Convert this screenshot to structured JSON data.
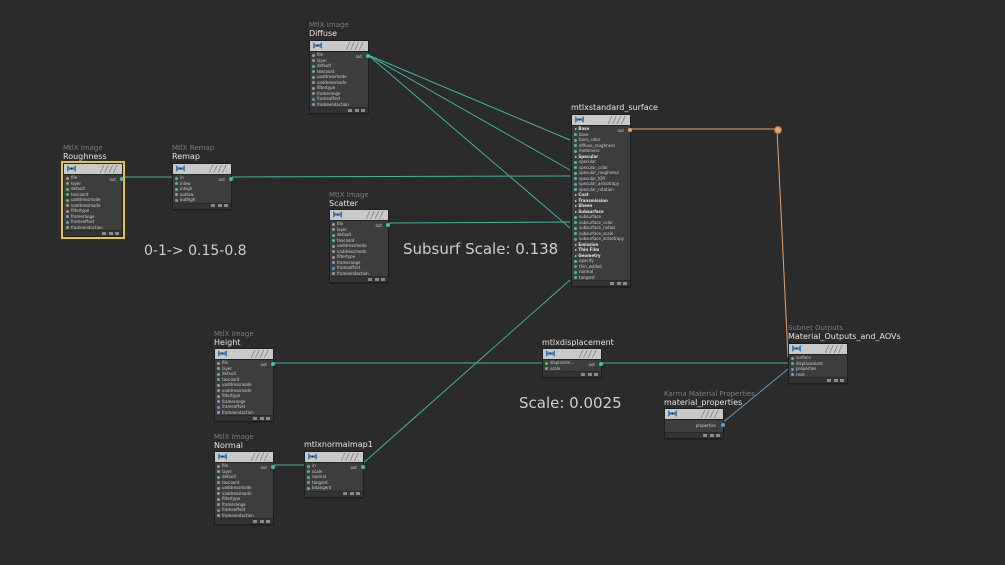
{
  "nodes": {
    "diffuse": {
      "type": "MtlX Image",
      "name": "Diffuse",
      "out": "out",
      "rows": [
        "file",
        "layer",
        "default",
        "texcoord",
        "uaddressmode",
        "vaddressmode",
        "filtertype",
        "framerange",
        "frameoffset",
        "frameendaction"
      ]
    },
    "roughness": {
      "type": "MtlX Image",
      "name": "Roughness",
      "out": "out",
      "rows": [
        "file",
        "layer",
        "default",
        "texcoord",
        "uaddressmode",
        "vaddressmode",
        "filtertype",
        "framerange",
        "frameoffset",
        "frameendaction"
      ]
    },
    "remap": {
      "type": "MtlX Remap",
      "name": "Remap",
      "out": "out",
      "rows": [
        "in",
        "inlow",
        "inhigh",
        "outlow",
        "outhigh"
      ]
    },
    "scatter": {
      "type": "MtlX Image",
      "name": "Scatter",
      "out": "out",
      "rows": [
        "file",
        "layer",
        "default",
        "texcoord",
        "uaddressmode",
        "vaddressmode",
        "filtertype",
        "framerange",
        "frameoffset",
        "frameendaction"
      ]
    },
    "surface": {
      "type": "",
      "name": "mtlxstandard_surface",
      "out": "out",
      "rows": [
        {
          "sec": "Base"
        },
        "base",
        "base_color",
        "diffuse_roughness",
        "metalness",
        {
          "sec": "Specular"
        },
        "specular",
        "specular_color",
        "specular_roughness",
        "specular_IOR",
        "specular_anisotropy",
        "specular_rotation",
        {
          "sec": "Coat"
        },
        {
          "sec": "Transmission"
        },
        {
          "sec": "Sheen"
        },
        {
          "sec": "Subsurface"
        },
        "subsurface",
        "subsurface_color",
        "subsurface_radius",
        "subsurface_scale",
        "subsurface_anisotropy",
        {
          "sec": "Emission"
        },
        {
          "sec": "Thin Film"
        },
        {
          "sec": "Geometry"
        },
        "opacity",
        "thin_walled",
        "normal",
        "tangent"
      ]
    },
    "height": {
      "type": "MtlX Image",
      "name": "Height",
      "out": "out",
      "rows": [
        "file",
        "layer",
        "default",
        "texcoord",
        "uaddressmode",
        "vaddressmode",
        "filtertype",
        "framerange",
        "frameoffset",
        "frameendaction"
      ]
    },
    "normal": {
      "type": "MtlX Image",
      "name": "Normal",
      "out": "out",
      "rows": [
        "file",
        "layer",
        "default",
        "texcoord",
        "uaddressmode",
        "vaddressmode",
        "filtertype",
        "framerange",
        "frameoffset",
        "frameendaction"
      ]
    },
    "normalmap": {
      "type": "",
      "name": "mtlxnormalmap1",
      "out": "out",
      "rows": [
        "in",
        "scale",
        "normal",
        "tangent",
        "bitangent"
      ]
    },
    "displacement": {
      "type": "",
      "name": "mtlxdisplacement",
      "out": "out",
      "rows": [
        "displacem...",
        "scale"
      ]
    },
    "outputs": {
      "type": "Subnet Outputs",
      "name": "Material_Outputs_and_AOVs",
      "rows": [
        "surface",
        "displacement",
        "properties",
        "next"
      ]
    },
    "matprops": {
      "type": "Karma Material Properties",
      "name": "material_properties",
      "out": "properties"
    }
  },
  "annotations": {
    "remap_note": "0-1-> 0.15-0.8",
    "subsurf_note": "Subsurf Scale: 0.138",
    "scale_note": "Scale: 0.0025"
  },
  "colors": {
    "wire": "#3fb89f",
    "wire_blue": "#5b9fd0",
    "selected": "#e8c43a",
    "background": "#2b2b2b"
  }
}
